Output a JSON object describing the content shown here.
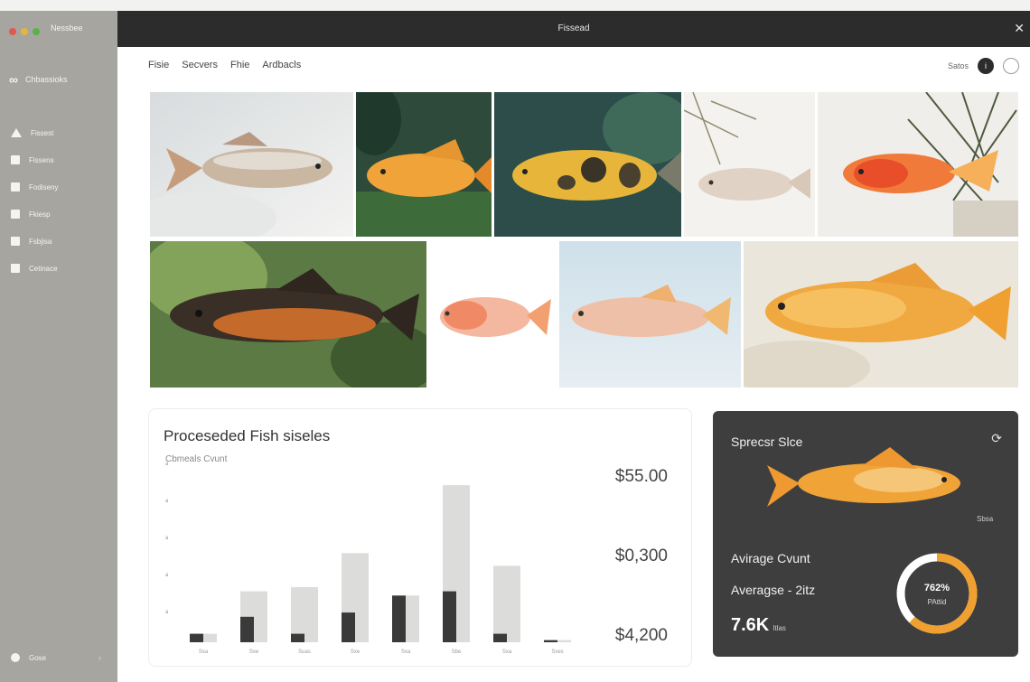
{
  "sidebar": {
    "app_name": "Nessbee",
    "brand": "Chbassioks",
    "items": [
      {
        "label": "Fissest",
        "icon": "triangle-icon"
      },
      {
        "label": "Fissens",
        "icon": "image-icon"
      },
      {
        "label": "Fodiseny",
        "icon": "folder-icon"
      },
      {
        "label": "Fkiesp",
        "icon": "doc-icon"
      },
      {
        "label": "Fsbjisa",
        "icon": "grid-icon"
      },
      {
        "label": "Cetinace",
        "icon": "settings-icon"
      }
    ],
    "footer": "Gose",
    "footer_caret": "›"
  },
  "window": {
    "title": "Fissead",
    "close": "✕"
  },
  "tabs": [
    "Fisie",
    "Secvers",
    "Fhie",
    "Ardbacls"
  ],
  "top_right": {
    "label": "Satos",
    "badge": "i"
  },
  "photos": [
    {
      "subject": "pale silver fish on rocky white background"
    },
    {
      "subject": "orange fish in green plants"
    },
    {
      "subject": "yellow fish with dark spots in green water"
    },
    {
      "subject": "pale fish with dry branches"
    },
    {
      "subject": "red-orange fish with pine branches"
    },
    {
      "subject": "dark bronze fish in green plants"
    },
    {
      "subject": "pink small fish on white"
    },
    {
      "subject": "pink fish on pale blue background"
    },
    {
      "subject": "golden orange fish on sandy background"
    }
  ],
  "chart": {
    "title": "Proceseded Fish siseles",
    "subtitle": "Cbmeals Cvunt",
    "values": [
      "$55.00",
      "$0,300",
      "$4,200"
    ]
  },
  "chart_data": {
    "type": "bar",
    "title": "Proceseded Fish siseles",
    "ylabel": "Cbmeals Cvunt",
    "categories": [
      "Sxa",
      "Sxe",
      "Suas",
      "Sxe",
      "Sxa",
      "Sbe",
      "Sxa",
      "Sxes"
    ],
    "series": [
      {
        "values": [
          2,
          12,
          13,
          21,
          11,
          37,
          18,
          0.5
        ]
      },
      {
        "values": [
          2,
          6,
          2,
          7,
          11,
          12,
          2,
          0.5
        ]
      }
    ],
    "ylim": [
      0,
      40
    ],
    "yticks": [
      "a",
      "a",
      "a",
      "a",
      "a"
    ],
    "colors": [
      "#dcdcda",
      "#3a3a3a"
    ]
  },
  "species": {
    "title": "Sprecsr Slce",
    "icon": "refresh-icon",
    "small_label": "Sbsa",
    "avg_label": "Avirage Cvunt",
    "avg_label2": "Averagse - 2itz",
    "big_value": "7.6K",
    "big_unit": "Itlas",
    "donut_value": 0.62,
    "donut_pct": "762%",
    "donut_sub": "PAttid",
    "accent": "#f0a030"
  }
}
